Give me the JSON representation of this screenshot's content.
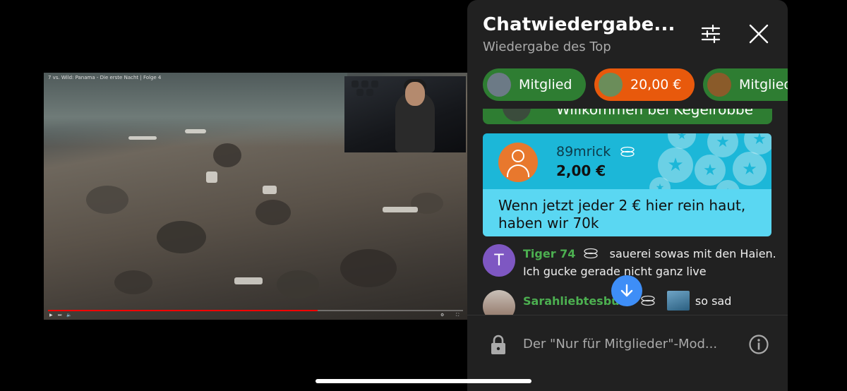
{
  "video": {
    "title": "7 vs. Wild: Panama - Die erste Nacht | Folge 4"
  },
  "chat": {
    "title": "Chatwiedergabe...",
    "subtitle": "Wiedergabe des Top",
    "ticker": [
      {
        "label": "Mitglied",
        "color": "#2e7d32"
      },
      {
        "label": "20,00 €",
        "color": "#e8590c"
      },
      {
        "label": "Mitglied",
        "color": "#2e7d32"
      }
    ],
    "member_banner": "Willkommen bei Kegelrobbe",
    "superchat": {
      "author": "89mrick",
      "amount": "2,00 €",
      "message": "Wenn jetzt jeder 2 € hier rein haut, haben wir 70k"
    },
    "messages": [
      {
        "avatar_letter": "T",
        "author": "Tiger 74",
        "text": "sauerei sowas mit den Haien. Ich gucke gerade nicht ganz live"
      },
      {
        "author": "Sarahliebtesbunt",
        "text": "so sad"
      }
    ],
    "footer": {
      "members_only": "Der \"Nur für Mitglieder\"-Mod..."
    }
  },
  "colors": {
    "member_green": "#2e7d32",
    "superchat_orange": "#e8590c",
    "superchat_cyan": "#1cb7d8",
    "accent_blue": "#3e8ef7"
  }
}
